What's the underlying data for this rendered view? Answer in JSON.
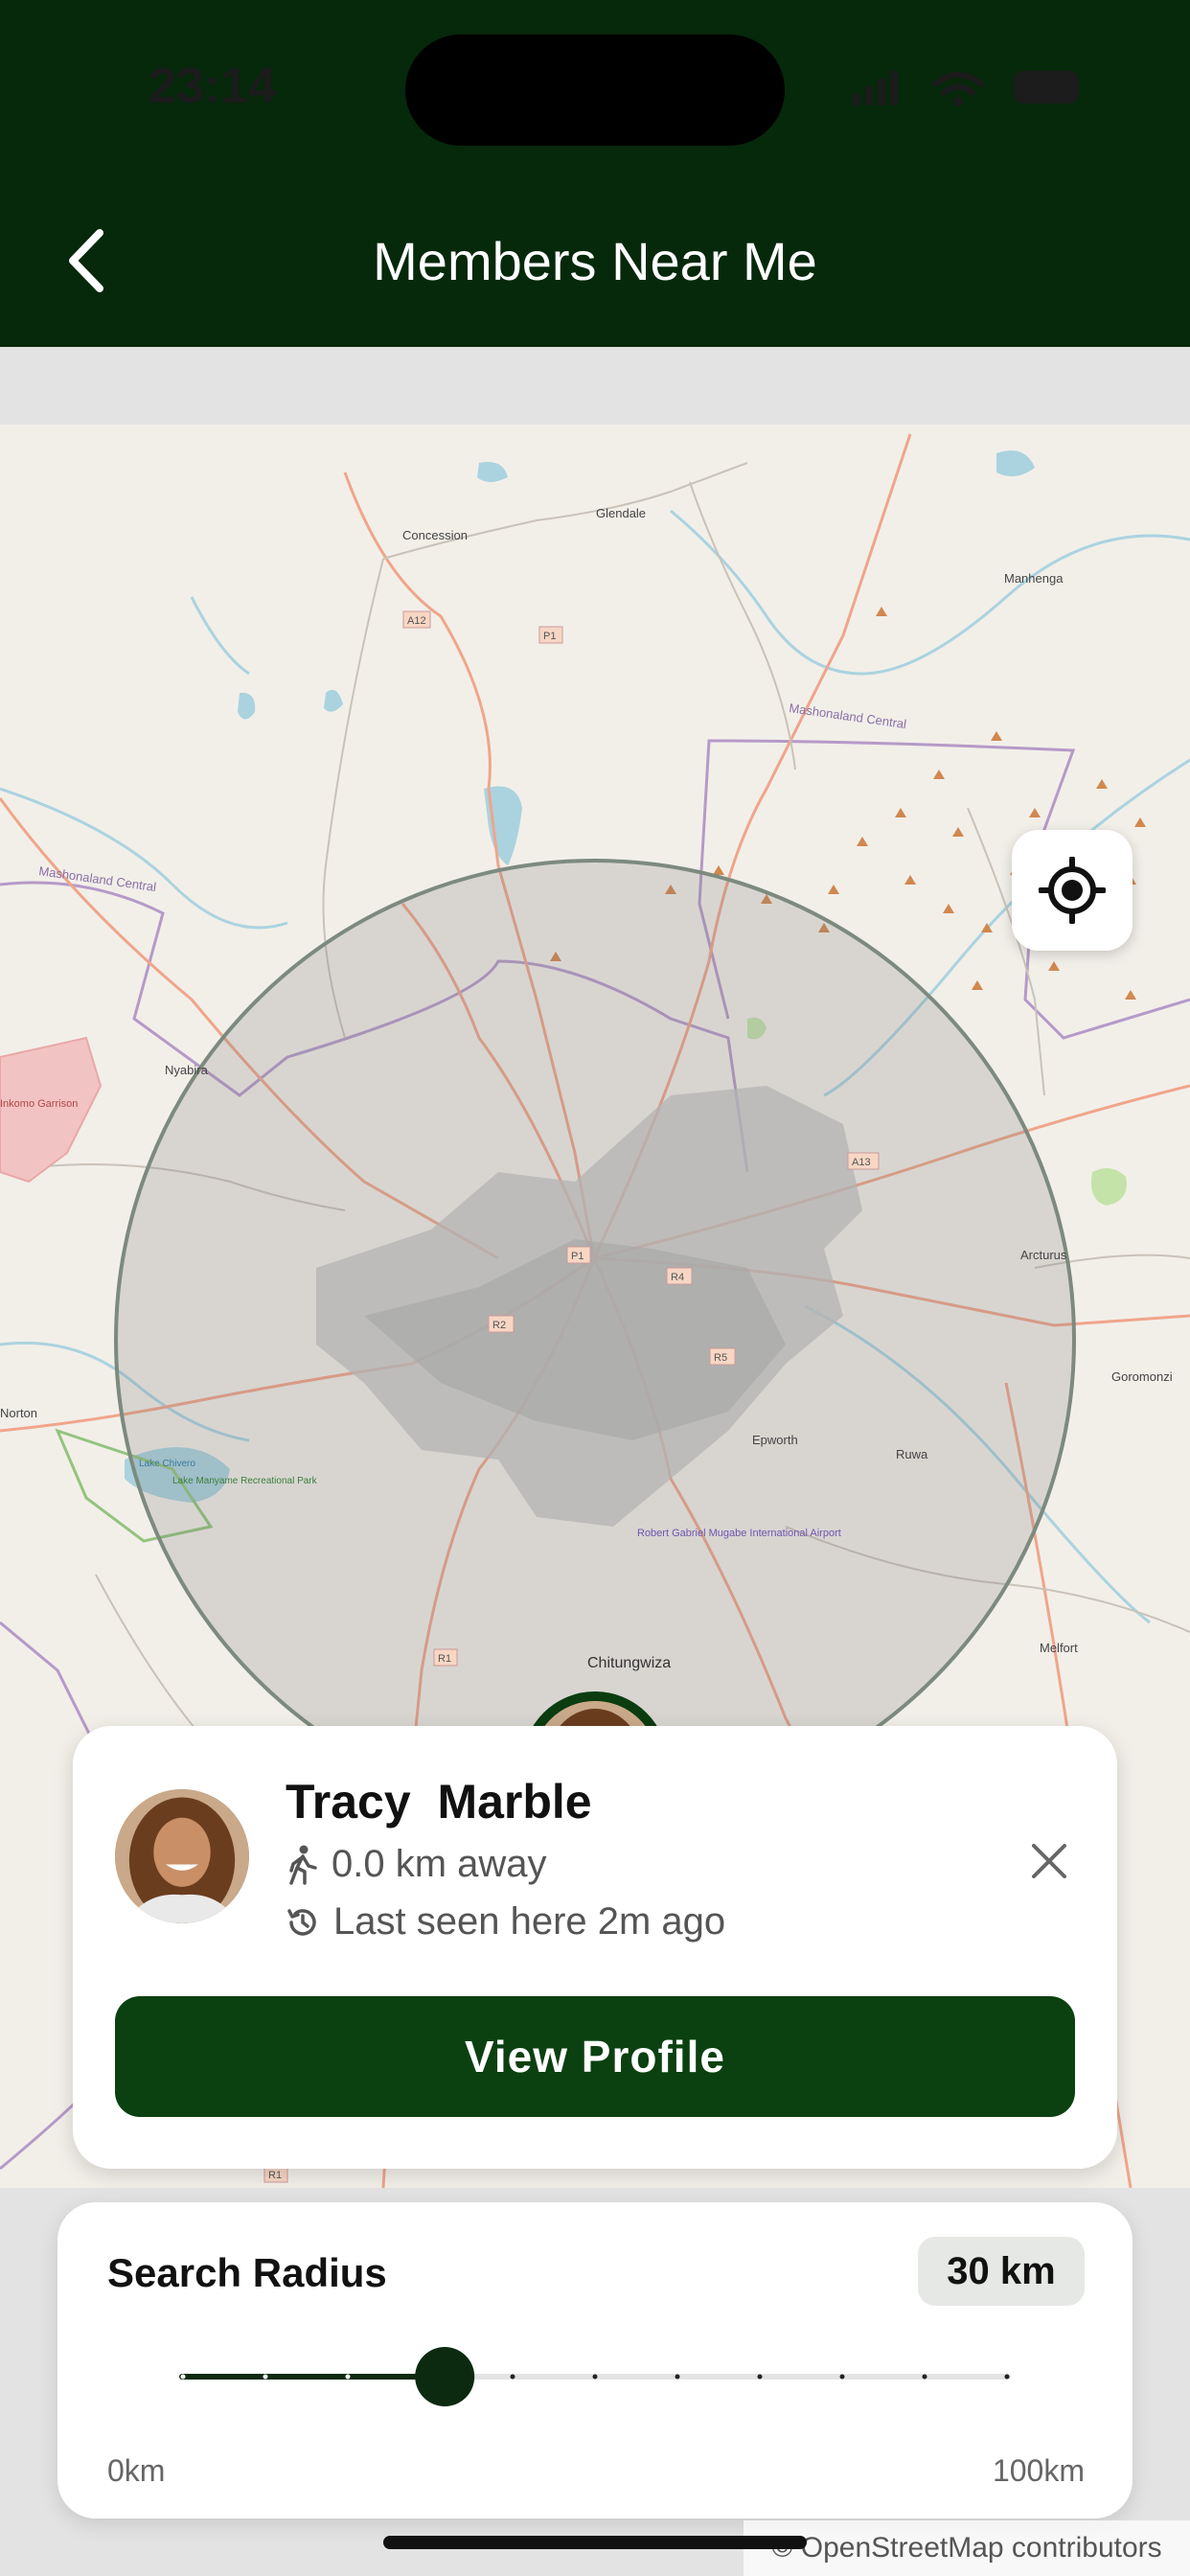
{
  "status_bar": {
    "time": "23:14"
  },
  "header": {
    "title": "Members Near Me",
    "back_icon": "chevron-left-icon"
  },
  "map": {
    "place_labels": [
      "Concession",
      "Glendale",
      "Manhenga",
      "Mashonaland Central",
      "Mashonaland Central",
      "Nyabira",
      "Arcturus",
      "Goromonzi",
      "Epworth",
      "Ruwa",
      "Chitungwiza",
      "Melfort",
      "Lake Chivero",
      "Lake Manyame Recreational Park",
      "Robert Gabriel Mugabe International Airport",
      "Inkomo Garrison",
      "Norton"
    ],
    "road_labels": [
      "A12",
      "P1",
      "P1",
      "A13",
      "R4",
      "R2",
      "R5",
      "R1",
      "R1"
    ],
    "locate_icon": "crosshair-location-icon"
  },
  "member_card": {
    "name": "Tracy  Marble",
    "distance": "0.0 km away",
    "last_seen": "Last seen here 2m ago",
    "distance_icon": "walking-person-icon",
    "seen_icon": "history-clock-icon",
    "close_icon": "close-icon",
    "view_button": "View Profile"
  },
  "search_radius": {
    "title": "Search Radius",
    "value_label": "30 km",
    "value": 30,
    "min": 0,
    "max": 100,
    "step": 10,
    "min_label": "0km",
    "max_label": "100km"
  },
  "attribution": "© OpenStreetMap contributors",
  "colors": {
    "header_bg": "#06280b",
    "accent": "#0b4010",
    "map_bg": "#f2efe9"
  }
}
